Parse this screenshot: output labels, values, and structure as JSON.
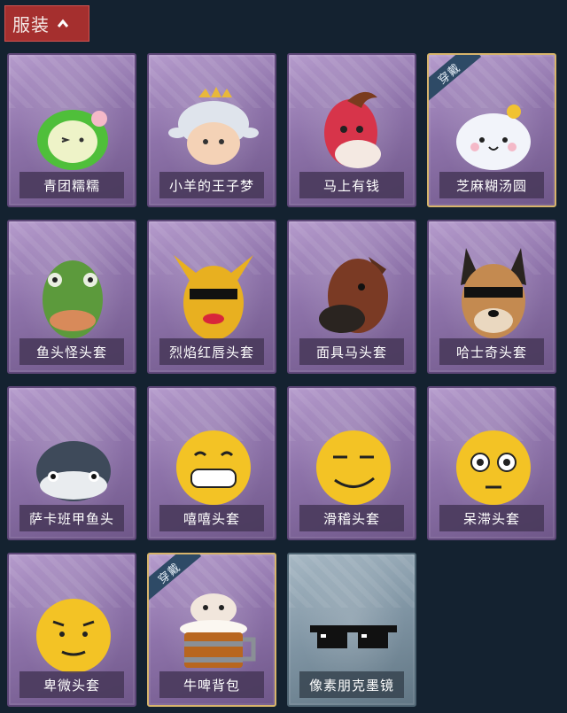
{
  "header": {
    "title": "服装"
  },
  "items": [
    {
      "label": "青团糯糯"
    },
    {
      "label": "小羊的王子梦"
    },
    {
      "label": "马上有钱"
    },
    {
      "label": "芝麻糊汤圆",
      "badge": "穿戴"
    },
    {
      "label": "鱼头怪头套"
    },
    {
      "label": "烈焰红唇头套"
    },
    {
      "label": "面具马头套"
    },
    {
      "label": "哈士奇头套"
    },
    {
      "label": "萨卡班甲鱼头"
    },
    {
      "label": "嘻嘻头套"
    },
    {
      "label": "滑稽头套"
    },
    {
      "label": "呆滞头套"
    },
    {
      "label": "卑微头套"
    },
    {
      "label": "牛啤背包",
      "badge": "穿戴"
    },
    {
      "label": "像素朋克墨镜"
    }
  ]
}
